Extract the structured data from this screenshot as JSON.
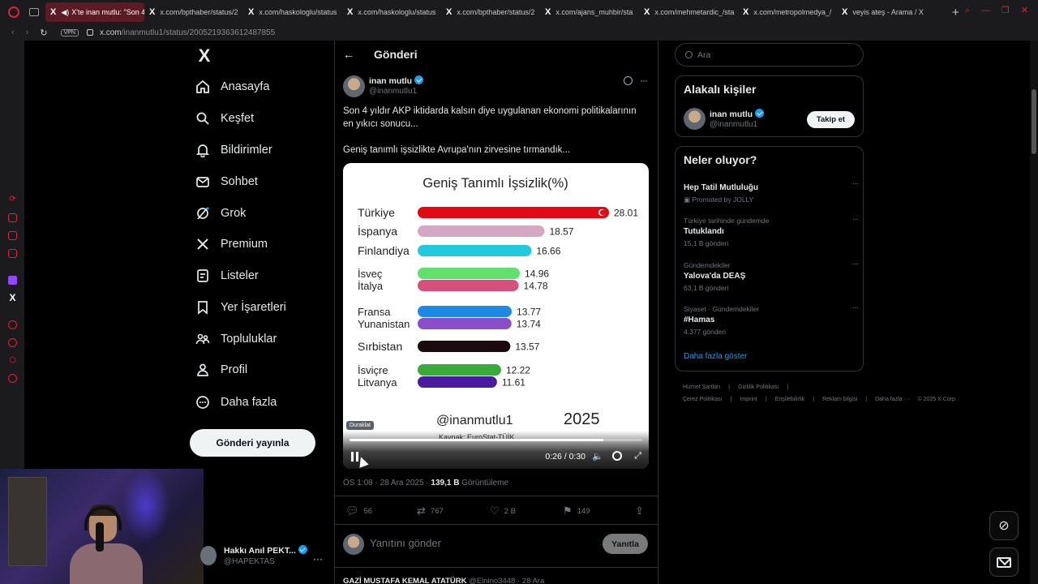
{
  "browser": {
    "tabs": [
      "X'te inan mutlu: \"Son 4",
      "x.com/bpthaber/status/2",
      "x.com/haskologlu/status",
      "x.com/haskologlu/status",
      "x.com/bpthaber/status/2",
      "x.com/ajans_muhbir/sta",
      "x.com/mehmetardic_/sta",
      "x.com/metropolmedya_/",
      "veyis ateş - Arama / X"
    ],
    "vpn": "VPN",
    "url_host": "x.com",
    "url_path": "/inanmutlu1/status/2005219363612487855"
  },
  "nav": {
    "items": [
      "Anasayfa",
      "Keşfet",
      "Bildirimler",
      "Sohbet",
      "Grok",
      "Premium",
      "Listeler",
      "Yer İşaretleri",
      "Topluluklar",
      "Profil",
      "Daha fazla"
    ],
    "post_button": "Gönderi yayınla"
  },
  "account": {
    "name": "Hakkı Anıl PEKT...",
    "handle": "@HAPEKTAS"
  },
  "header": {
    "back": "←",
    "title": "Gönderi"
  },
  "tweet": {
    "author_name": "inan mutlu",
    "author_handle": "@inanmutlu1",
    "text1": "Son 4 yıldır AKP iktidarda kalsın diye uygulanan ekonomi politikalarının en yıkıcı sonucu...",
    "text2": "Geniş tanımlı işsizlikte Avrupa'nın zirvesine tırmandık...",
    "time": "ÖS 1:08 · 28 Ara 2025 · ",
    "views_count": "139,1 B",
    "views_label": " Görüntüleme",
    "stats": {
      "replies": "56",
      "reposts": "767",
      "likes": "2 B",
      "bookmarks": "149"
    }
  },
  "video": {
    "paused_tooltip": "Duraklat",
    "time": "0:26 / 0:30",
    "progress": 0.867
  },
  "chart_data": {
    "type": "bar",
    "title": "Geniş Tanımlı İşsizlik(%)",
    "categories": [
      "Türkiye",
      "İspanya",
      "Finlandiya",
      "İsveç",
      "İtalya",
      "Fransa",
      "Yunanistan",
      "Sırbistan",
      "İsviçre",
      "Litvanya"
    ],
    "values": [
      28.01,
      18.57,
      16.66,
      14.96,
      14.78,
      13.77,
      13.74,
      13.57,
      12.22,
      11.61
    ],
    "value_labels": [
      "28.01",
      "18.57",
      "16.66",
      "14.96",
      "14.78",
      "13.77",
      "13.74",
      "13.57",
      "12.22",
      "11.61"
    ],
    "colors": [
      "#e10a14",
      "#d4a8c4",
      "#22c8dc",
      "#62e06e",
      "#d6507e",
      "#1e88e5",
      "#8a4fc8",
      "#1a0a0e",
      "#3aaa3a",
      "#4a1aa0"
    ],
    "groups": [
      [
        0
      ],
      [
        1
      ],
      [
        2
      ],
      [
        3,
        4
      ],
      [
        5,
        6
      ],
      [
        7
      ],
      [
        8,
        9
      ]
    ],
    "watermark": "@inanmutlu1",
    "year": "2025",
    "source": "Kaynak: EuroStat-TÜİK"
  },
  "reply": {
    "placeholder": "Yanıtını gönder",
    "button": "Yanıtla"
  },
  "next_reply": {
    "name": "GAZİ MUSTAFA KEMAL ATATÜRK",
    "handle": "@Elnino3448 · 28 Ara"
  },
  "right": {
    "search_placeholder": "Ara",
    "related_title": "Alakalı kişiler",
    "related_name": "inan mutlu",
    "related_handle": "@inanmutlu1",
    "follow": "Takip et",
    "trends_title": "Neler oluyor?",
    "trends": [
      {
        "ctx": "",
        "title": "Hep Tatil Mutluluğu",
        "sub": "Promoted by JOLLY"
      },
      {
        "ctx": "Türkiye tarihinde gündemde",
        "title": "Tutuklandı",
        "sub": "15,1 B gönderi"
      },
      {
        "ctx": "Gündemdekiler",
        "title": "Yalova'da DEAŞ",
        "sub": "63,1 B gönderi"
      },
      {
        "ctx": "Siyaset · Gündemdekiler",
        "title": "#Hamas",
        "sub": "4.377 gönderi"
      }
    ],
    "show_more": "Daha fazla göster",
    "footer": [
      "Hizmet Şartları",
      "|",
      "Gizlilik Politikası",
      "|",
      "Çerez Politikası",
      "|",
      "Imprint",
      "|",
      "Erişilebilirlik",
      "|",
      "Reklam bilgisi",
      "|",
      "Daha fazla ···",
      "© 2025 X Corp."
    ]
  }
}
